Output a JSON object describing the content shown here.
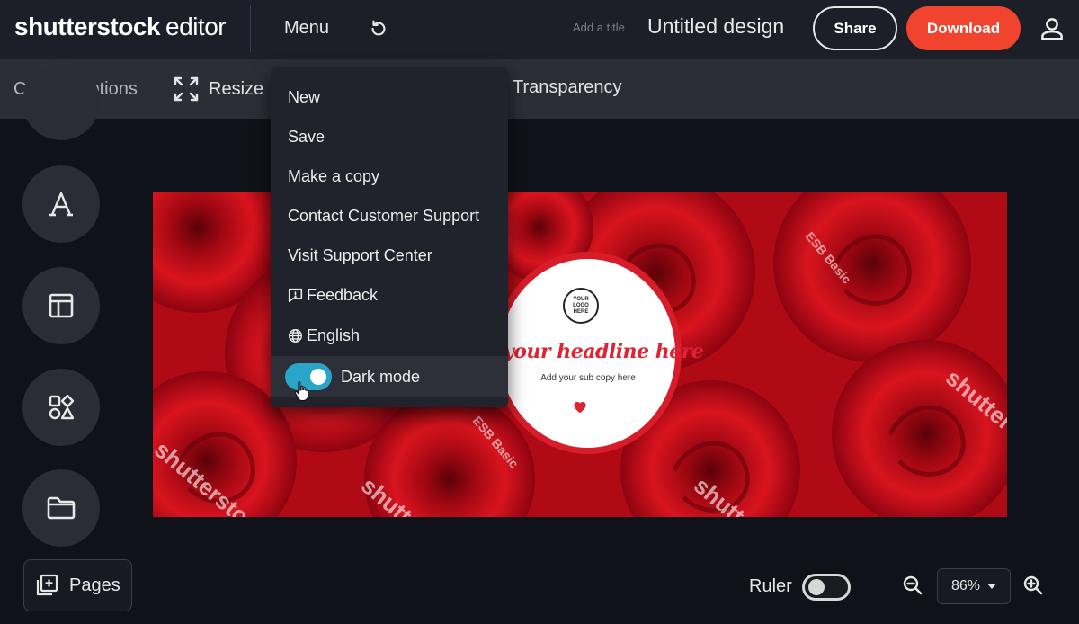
{
  "app": {
    "brand": "shutterstock",
    "product": "editor"
  },
  "topbar": {
    "menu_label": "Menu",
    "title_hint": "Add a title",
    "title": "Untitled design",
    "share_label": "Share",
    "download_label": "Download"
  },
  "toolbar": {
    "canvas_options_label": "Canvas options",
    "resize_label": "Resize",
    "transparency_label": "Transparency"
  },
  "menu": {
    "items": [
      {
        "label": "New"
      },
      {
        "label": "Save"
      },
      {
        "label": "Make a copy"
      },
      {
        "label": "Contact Customer Support"
      },
      {
        "label": "Visit Support Center"
      },
      {
        "label": "Feedback",
        "icon": "feedback-icon"
      },
      {
        "label": "English",
        "icon": "globe-icon"
      }
    ],
    "dark_mode_label": "Dark mode",
    "dark_mode_on": true
  },
  "sidebar": {
    "tools": [
      {
        "icon": "text-icon"
      },
      {
        "icon": "layout-icon"
      },
      {
        "icon": "shapes-icon"
      },
      {
        "icon": "folder-icon"
      }
    ]
  },
  "canvas": {
    "logo_text": "YOUR LOGO HERE",
    "headline": "your headline here",
    "subcopy": "Add your sub copy here",
    "watermark": "shutterstock",
    "watermark_small": "ESB Basic"
  },
  "bottombar": {
    "pages_label": "Pages",
    "ruler_label": "Ruler",
    "ruler_on": false,
    "zoom": "86%"
  },
  "colors": {
    "accent": "#f0442f",
    "toggle_on": "#2aa5c8",
    "topbar_bg": "#1c1f27",
    "toolbar_bg": "#2b2e37",
    "canvas_bg": "#101219"
  }
}
